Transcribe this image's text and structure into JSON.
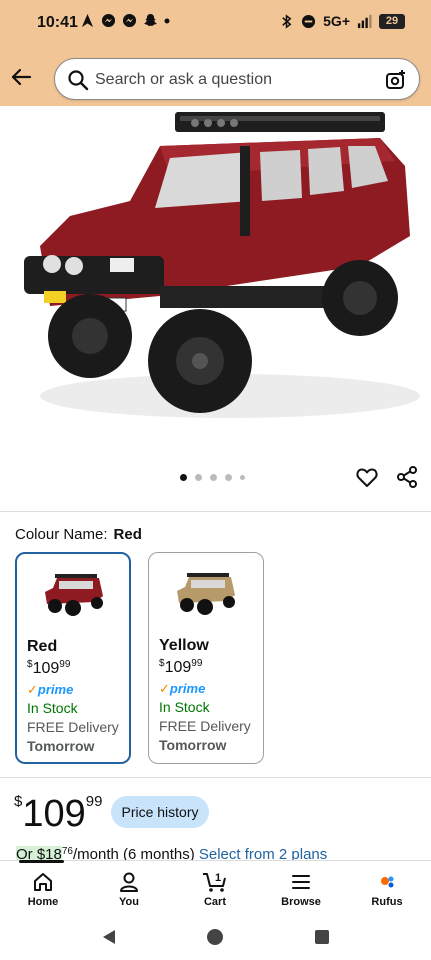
{
  "status_bar": {
    "time": "10:41",
    "network": "5G+",
    "battery": "29",
    "left_icons": [
      "navigation-icon",
      "messenger-icon",
      "messenger-icon",
      "snapchat-icon",
      "dot-icon"
    ],
    "right_icons": [
      "bluetooth-icon",
      "dnd-icon",
      "signal-icon"
    ]
  },
  "header": {
    "search_placeholder": "Search or ask a question"
  },
  "gallery": {
    "image_count": 5,
    "active_index": 0
  },
  "colour": {
    "label": "Colour Name:",
    "selected": "Red",
    "options": [
      {
        "name": "Red",
        "currency": "$",
        "price_whole": "109",
        "price_cents": "99",
        "prime": "prime",
        "stock": "In Stock",
        "delivery": "FREE Delivery",
        "when": "Tomorrow",
        "car_color": "#8e1b22"
      },
      {
        "name": "Yellow",
        "currency": "$",
        "price_whole": "109",
        "price_cents": "99",
        "prime": "prime",
        "stock": "In Stock",
        "delivery": "FREE Delivery",
        "when": "Tomorrow",
        "car_color": "#b79a6a"
      }
    ]
  },
  "price": {
    "currency": "$",
    "whole": "109",
    "cents": "99",
    "history_button": "Price history"
  },
  "monthly": {
    "lead": "Or $18",
    "cents": "76",
    "rest": "/month (6 months)",
    "link": "Select from 2 plans"
  },
  "bottom_nav": {
    "items": [
      {
        "label": "Home",
        "icon": "home-icon"
      },
      {
        "label": "You",
        "icon": "person-icon"
      },
      {
        "label": "Cart",
        "icon": "cart-icon",
        "badge": "1"
      },
      {
        "label": "Browse",
        "icon": "menu-icon"
      },
      {
        "label": "Rufus",
        "icon": "rufus-icon"
      }
    ]
  },
  "colors": {
    "header_bg": "#f2c597",
    "accent_blue": "#2162a1",
    "in_stock": "#007600",
    "car_red": "#8e1b22"
  }
}
